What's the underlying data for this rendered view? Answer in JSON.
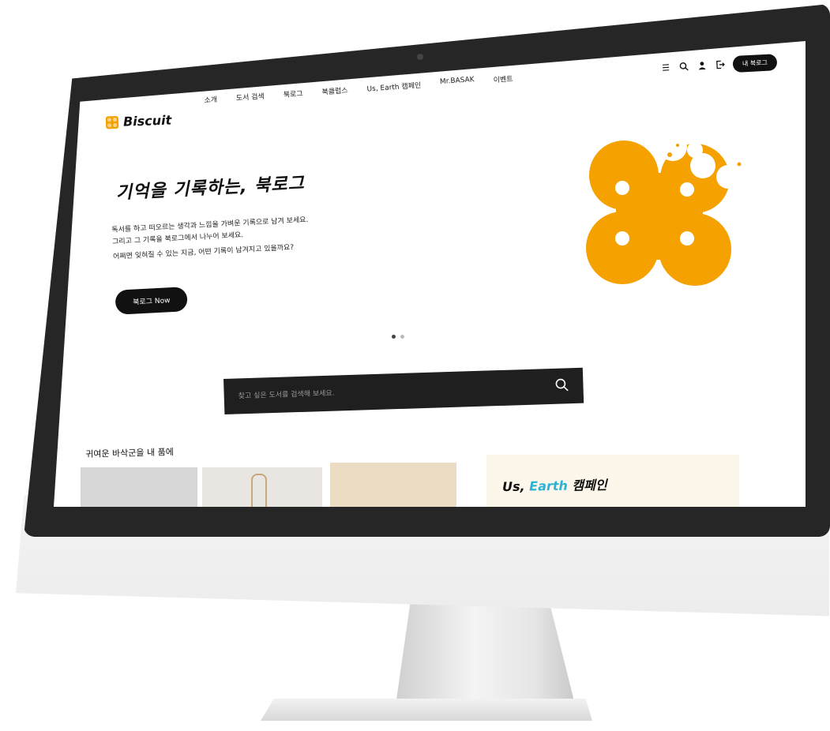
{
  "header": {
    "logo_text": "Biscuit",
    "nav": [
      "소개",
      "도서 검색",
      "북로그",
      "북클럽스",
      "Us, Earth 캠페인",
      "Mr.BASAK",
      "이벤트"
    ],
    "my_booklog_label": "내 북로그"
  },
  "hero": {
    "title": "기억을 기록하는, 북로그",
    "desc_lines": [
      "독서를 하고 떠오르는 생각과 느낌을 가벼운 기록으로 남겨 보세요.",
      "그리고 그 기록을 북로그에서 나누어 보세요.",
      "어쩌면 잊혀질 수 있는 지금, 어떤 기록이 남겨지고 있을까요?"
    ],
    "cta_label": "북로그 Now",
    "slide_total": 2,
    "slide_active": 1
  },
  "search": {
    "placeholder": "찾고 싶은 도서를 검색해 보세요."
  },
  "section": {
    "title": "귀여운 바삭군을 내 품에"
  },
  "campaign": {
    "title_prefix": "Us, ",
    "title_highlight": "Earth",
    "title_suffix": " 캠페인"
  },
  "colors": {
    "accent": "#f5a100",
    "dark": "#1f1f1f",
    "earth": "#2bb3d6"
  },
  "icons": [
    "menu-icon",
    "search-icon",
    "user-icon",
    "logout-icon"
  ]
}
